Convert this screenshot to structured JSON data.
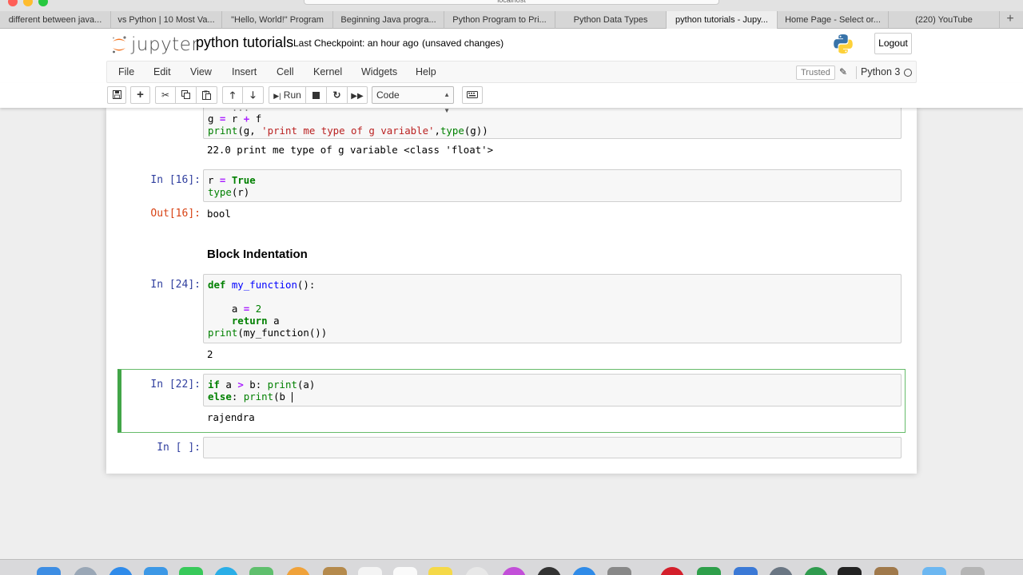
{
  "browser": {
    "url": "localhost",
    "tabs": [
      {
        "label": "different between java..."
      },
      {
        "label": "vs Python | 10 Most Va..."
      },
      {
        "label": "\"Hello, World!\" Program"
      },
      {
        "label": "Beginning Java progra..."
      },
      {
        "label": "Python Program to Pri..."
      },
      {
        "label": "Python Data Types"
      },
      {
        "label": "python tutorials - Jupy...",
        "active": true
      },
      {
        "label": "Home Page - Select or..."
      },
      {
        "label": "(220) YouTube"
      }
    ],
    "new_tab": "+"
  },
  "header": {
    "logo_text": "jupyter",
    "notebook_name": "python tutorials",
    "checkpoint": "Last Checkpoint: an hour ago",
    "unsaved": "(unsaved changes)",
    "logout_label": "Logout"
  },
  "menubar": {
    "items": [
      "File",
      "Edit",
      "View",
      "Insert",
      "Cell",
      "Kernel",
      "Widgets",
      "Help"
    ],
    "trusted": "Trusted",
    "kernel": "Python 3"
  },
  "toolbar": {
    "run_label": "Run",
    "cell_type": "Code"
  },
  "cells": {
    "cell0": {
      "line_top": "    ...",
      "line1": [
        "g ",
        "=",
        " r ",
        "+",
        " f"
      ],
      "line2_fn": "print",
      "line2_a": "(g, ",
      "line2_str": "'print me type of g variable'",
      "line2_b": ",",
      "line2_fn2": "type",
      "line2_c": "(g))",
      "output": "22.0 print me type of g variable <class 'float'>"
    },
    "cell1": {
      "prompt": "In [16]:",
      "line1_a": "r ",
      "line1_op": "=",
      "line1_kw": " True",
      "line2_fn": "type",
      "line2_a": "(r)",
      "out_prompt": "Out[16]:",
      "output": "bool"
    },
    "markdown": {
      "heading": "Block Indentation"
    },
    "cell2": {
      "prompt": "In [24]:",
      "line1_kw": "def",
      "line1_fn": " my_function",
      "line1_a": "():",
      "line3_a": "    a ",
      "line3_op": "=",
      "line3_num": " 2",
      "line4_kw": "    return",
      "line4_a": " a",
      "line5_fn": "print",
      "line5_a": "(my_function())",
      "output": "2"
    },
    "cell3": {
      "prompt": "In [22]:",
      "line1_kw": "if",
      "line1_a": " a ",
      "line1_op": ">",
      "line1_b": " b: ",
      "line1_fn": "print",
      "line1_c": "(a)",
      "line2_kw": "else",
      "line2_a": ": ",
      "line2_fn": "print",
      "line2_b": "(b",
      "output": "rajendra"
    },
    "cell4": {
      "prompt": "In [ ]:"
    }
  },
  "colors": {
    "prompt_in": "#303f9f",
    "prompt_out": "#d84315",
    "selected_cell": "#42a548",
    "keyword": "#008000",
    "operator": "#aa22ff",
    "string": "#ba2121"
  },
  "icons": {
    "save": "floppy-disk-icon",
    "add": "plus-icon",
    "cut": "scissors-icon",
    "copy": "copy-icon",
    "paste": "paste-icon",
    "move_up": "arrow-up-icon",
    "move_down": "arrow-down-icon",
    "run": "step-forward-icon",
    "interrupt": "stop-icon",
    "restart": "refresh-icon",
    "restart_run": "fast-forward-icon",
    "command_palette": "keyboard-icon",
    "edit": "pencil-icon",
    "kernel_status": "circle-icon"
  }
}
